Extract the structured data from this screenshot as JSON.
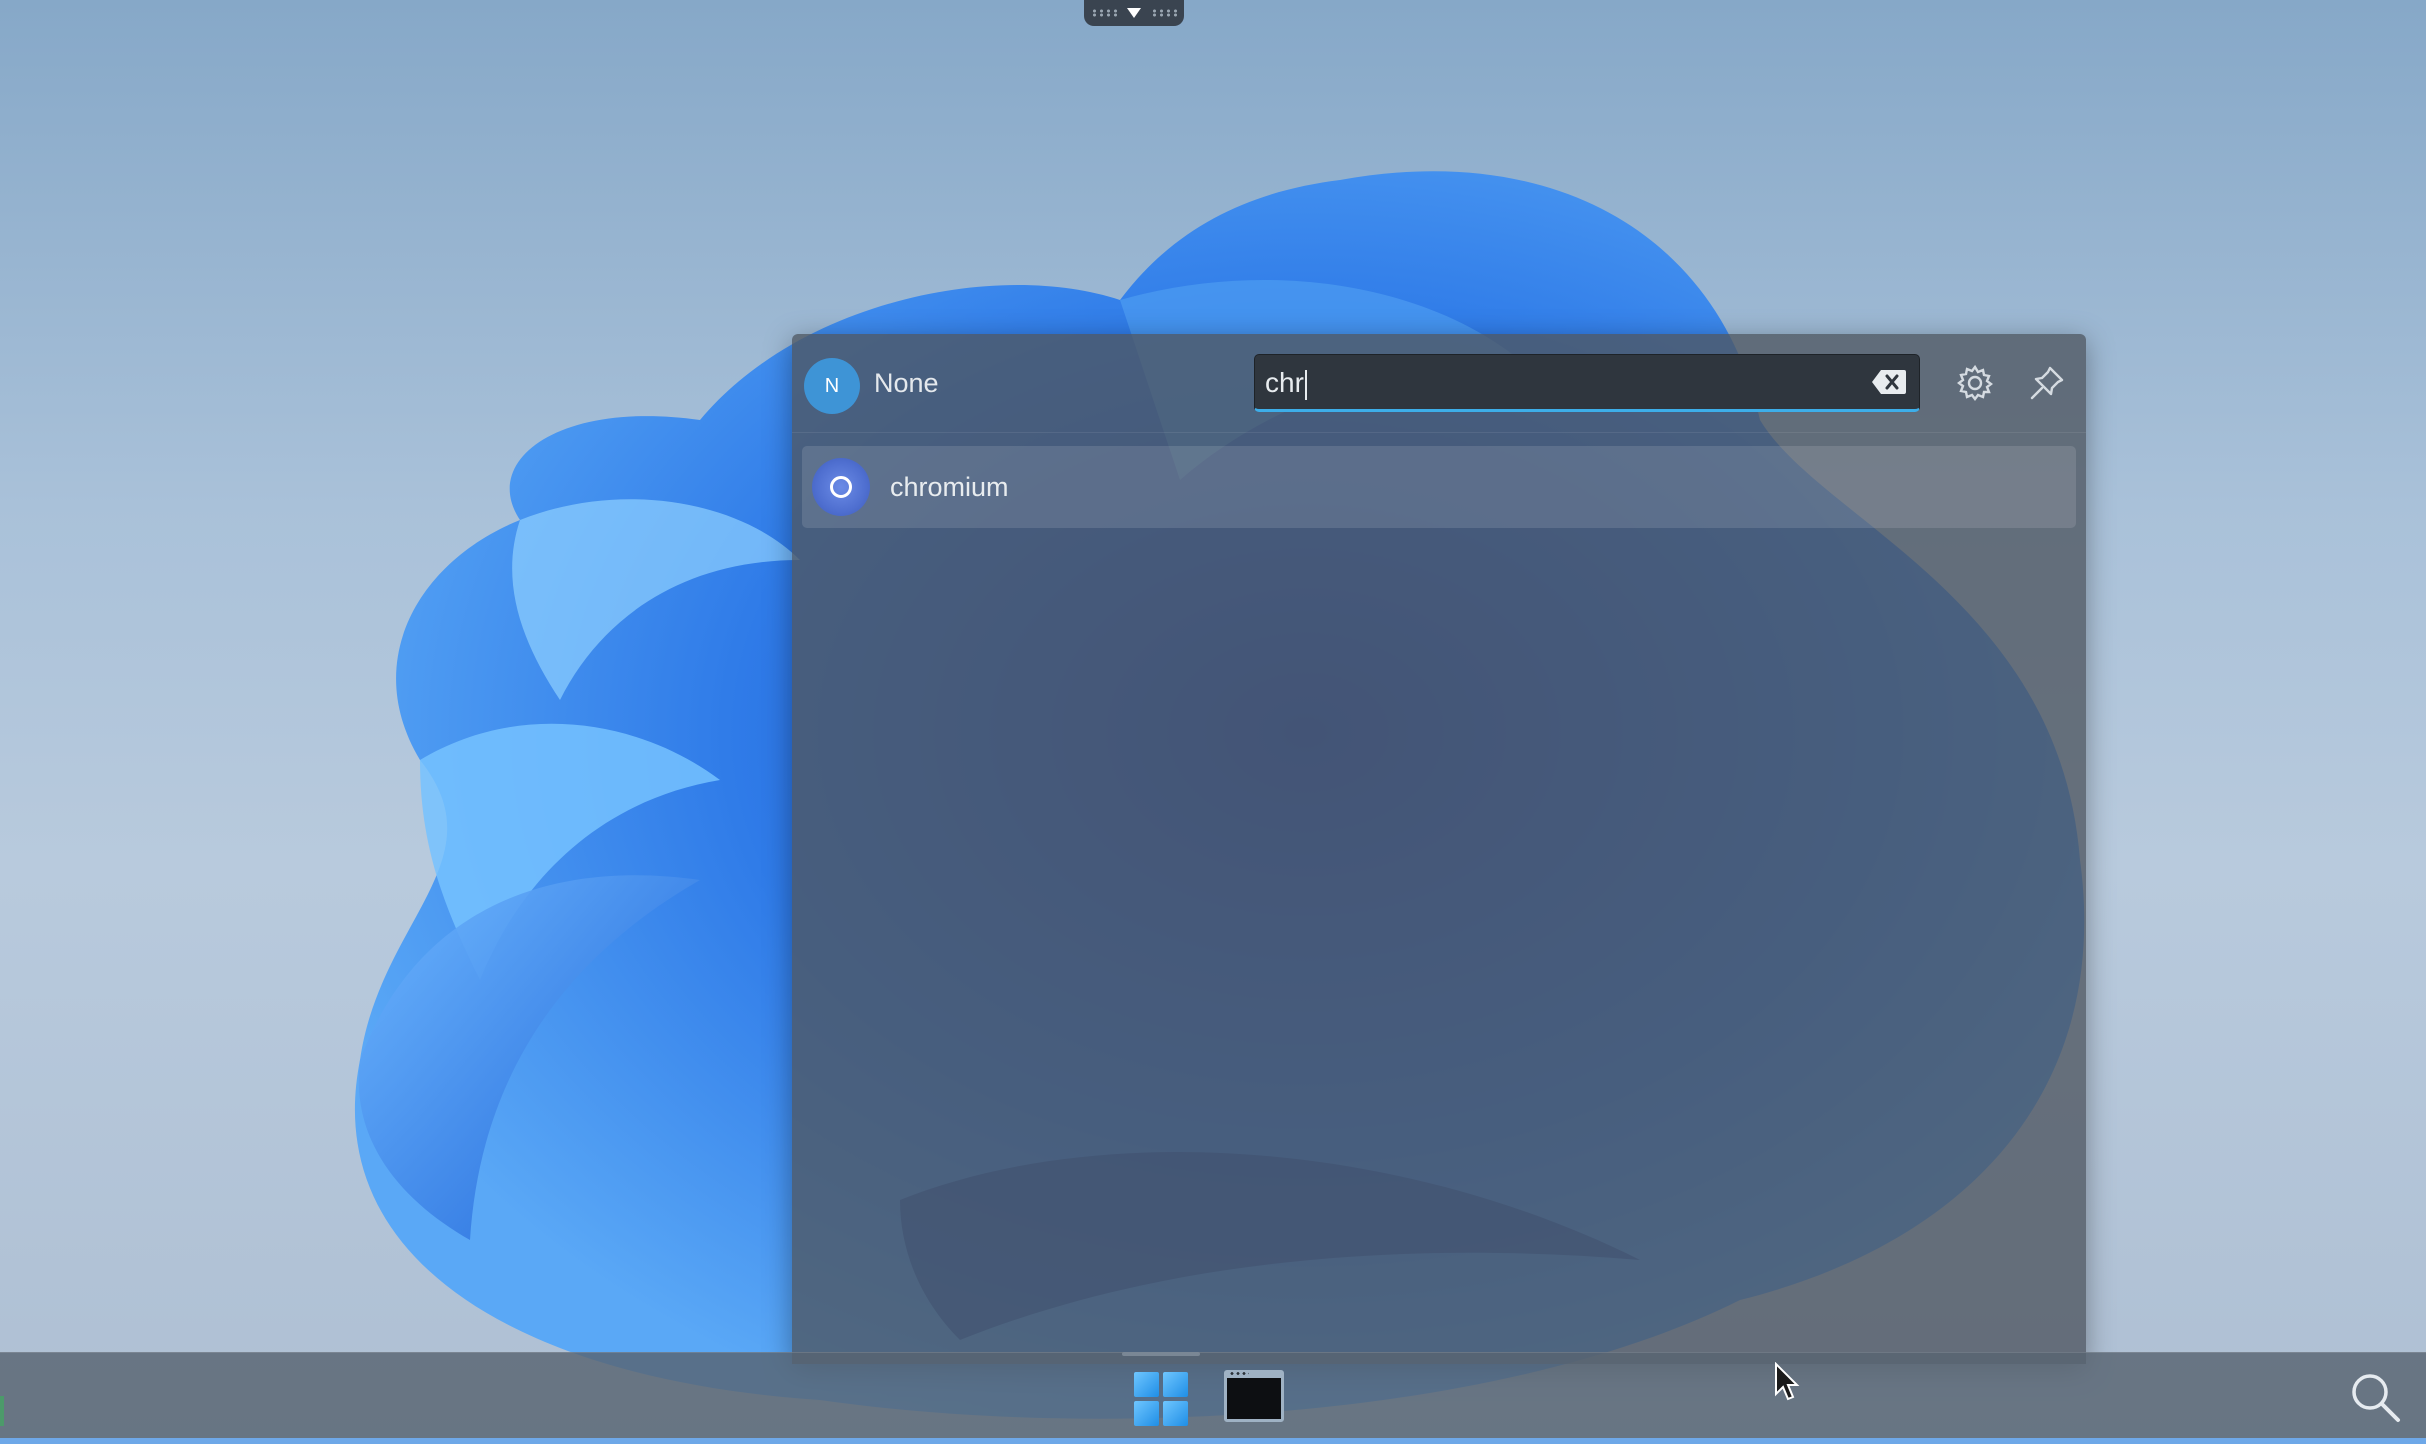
{
  "launcher": {
    "user": {
      "initial": "N",
      "name": "None"
    },
    "search": {
      "value": "chr"
    },
    "results": [
      {
        "label": "chromium",
        "icon": "chromium-icon"
      }
    ],
    "icons": {
      "clear": "backspace-clear-icon",
      "settings": "gear-icon",
      "pin": "pin-icon"
    }
  },
  "taskbar": {
    "items": [
      {
        "name": "start-menu",
        "icon": "windows-logo-icon"
      },
      {
        "name": "terminal",
        "icon": "terminal-icon"
      }
    ],
    "search_icon": "search-icon"
  },
  "colors": {
    "accent": "#3daee9",
    "avatar": "#3e94d6"
  }
}
